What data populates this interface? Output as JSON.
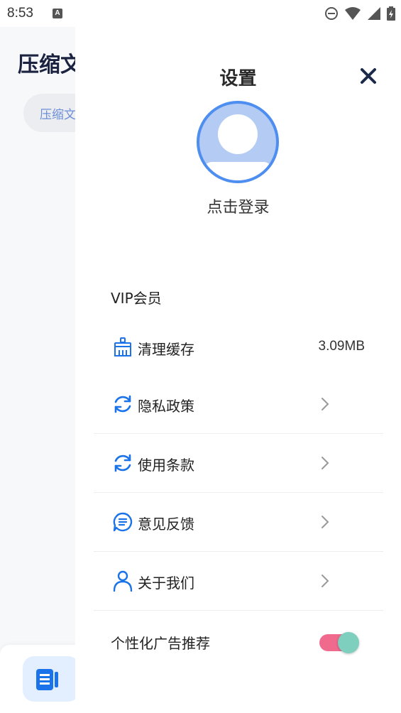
{
  "status_bar": {
    "time": "8:53",
    "notif_letter": "A"
  },
  "background": {
    "title": "压缩文",
    "pill_label": "压缩文"
  },
  "drawer": {
    "title": "设置",
    "login_label": "点击登录",
    "vip_label": "VIP会员",
    "menu": [
      {
        "label": "清理缓存",
        "value": "3.09MB",
        "icon": "broom-icon"
      },
      {
        "label": "隐私政策",
        "icon": "refresh-icon"
      },
      {
        "label": "使用条款",
        "icon": "refresh-icon"
      },
      {
        "label": "意见反馈",
        "icon": "message-icon"
      },
      {
        "label": "关于我们",
        "icon": "user-icon"
      }
    ],
    "ad_toggle": {
      "label": "个性化广告推荐",
      "on": true
    }
  },
  "colors": {
    "accent": "#4d8ef0",
    "icon_blue": "#1a73e8",
    "toggle_track": "#f06a8e",
    "toggle_knob": "#7ecfbd"
  }
}
